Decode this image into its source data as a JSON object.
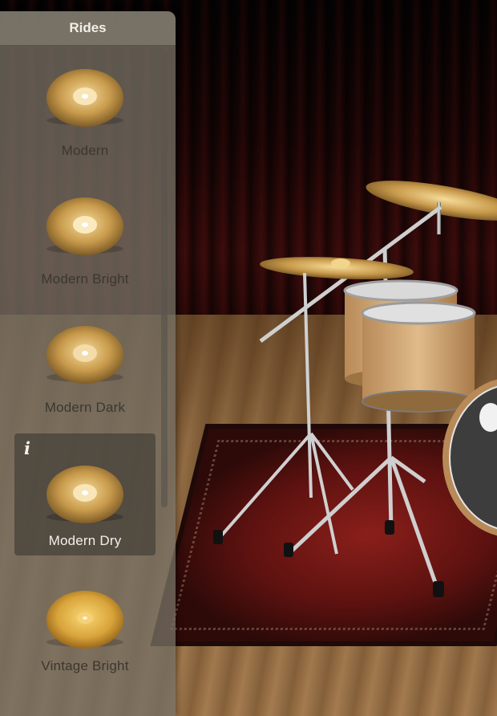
{
  "panel": {
    "title": "Rides",
    "info_glyph": "i",
    "items": [
      {
        "label": "Modern",
        "icon": "ride-cymbal-icon",
        "selected": false
      },
      {
        "label": "Modern Bright",
        "icon": "ride-cymbal-icon",
        "selected": false
      },
      {
        "label": "Modern Dark",
        "icon": "ride-cymbal-icon",
        "selected": false
      },
      {
        "label": "Modern Dry",
        "icon": "ride-cymbal-icon",
        "selected": true
      },
      {
        "label": "Vintage Bright",
        "icon": "ride-cymbal-icon",
        "selected": false
      }
    ]
  },
  "colors": {
    "panel_bg": "#767064",
    "selected_bg": "#46423a",
    "selected_text": "#f3f0ea",
    "label_text": "#3b3731"
  }
}
